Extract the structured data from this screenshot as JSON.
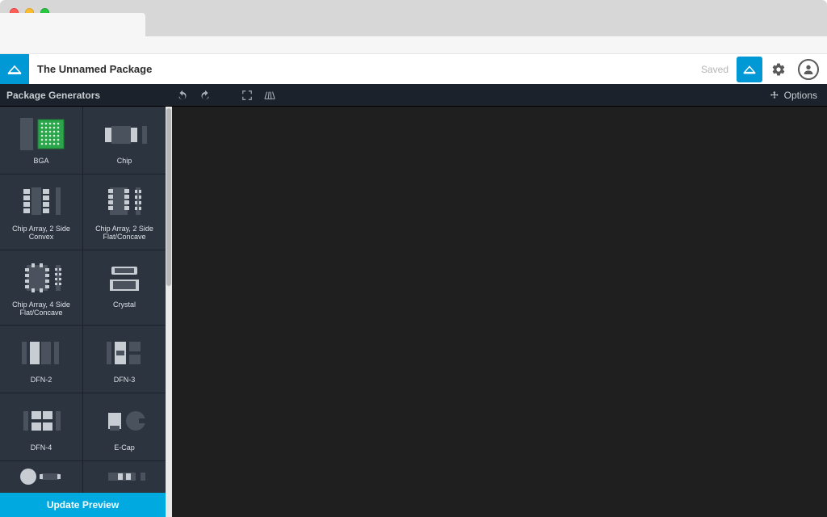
{
  "colors": {
    "accent": "#0099d6",
    "update": "#00a9e0",
    "panel": "#2c3440",
    "toolbar": "#1b222c",
    "canvas": "#1f1f1f"
  },
  "header": {
    "title": "The Unnamed Package",
    "status": "Saved"
  },
  "toolbar": {
    "section_label": "Package Generators",
    "options_label": "Options"
  },
  "sidebar": {
    "update_label": "Update Preview",
    "items": [
      {
        "label": "BGA"
      },
      {
        "label": "Chip"
      },
      {
        "label": "Chip Array, 2 Side Convex"
      },
      {
        "label": "Chip Array, 2 Side Flat/Concave"
      },
      {
        "label": "Chip Array, 4 Side Flat/Concave"
      },
      {
        "label": "Crystal"
      },
      {
        "label": "DFN-2"
      },
      {
        "label": "DFN-3"
      },
      {
        "label": "DFN-4"
      },
      {
        "label": "E-Cap"
      },
      {
        "label": ""
      },
      {
        "label": ""
      }
    ]
  }
}
